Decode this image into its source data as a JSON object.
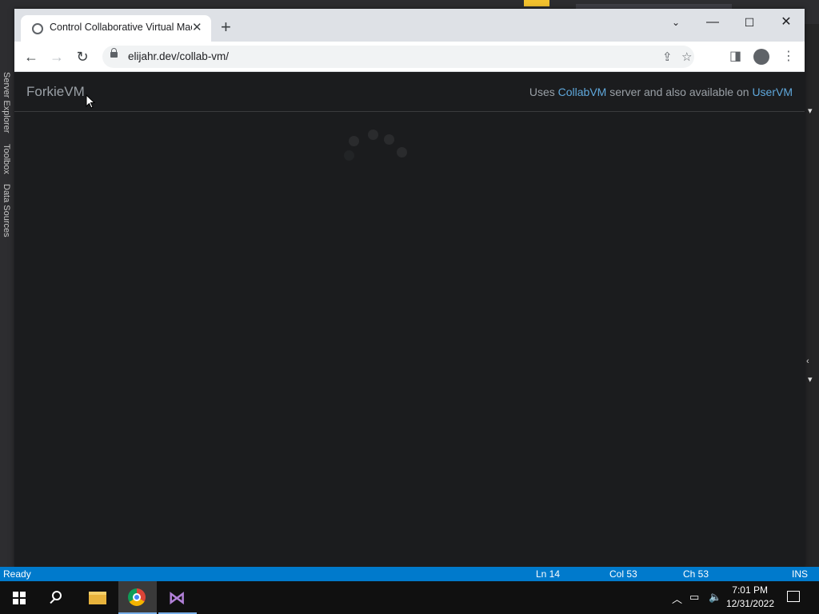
{
  "browser": {
    "tab_title": "Control Collaborative Virtual Machine",
    "url": "elijahr.dev/collab-vm/"
  },
  "page": {
    "brand": "ForkieVM",
    "note_prefix": "Uses ",
    "note_link1": "CollabVM",
    "note_middle": " server and also available on ",
    "note_link2": "UserVM"
  },
  "ide": {
    "rail_labels": [
      "Server Explorer",
      "Toolbox",
      "Data Sources"
    ],
    "status": {
      "ready": "Ready",
      "ln": "Ln 14",
      "col": "Col 53",
      "ch": "Ch 53",
      "mode": "INS"
    }
  },
  "taskbar": {
    "time": "7:01 PM",
    "date": "12/31/2022"
  },
  "colors": {
    "statusbar": "#007acc",
    "page_bg": "#1b1c1e",
    "link": "#5fa8dc"
  }
}
